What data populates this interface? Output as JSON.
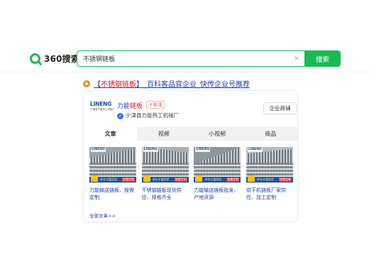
{
  "header": {
    "logo_text": "360搜索",
    "search_value": "不锈钢链板",
    "clear_symbol": "×",
    "search_button": "搜索"
  },
  "result": {
    "title_prefix": "【",
    "title_highlight": "不锈钢链板",
    "title_suffix": "】_百科客品官企业_快传企业号推荐"
  },
  "company": {
    "logo_brand": "LINENG",
    "logo_sub": "宁津县力能热工机械厂",
    "name_prefix": "力能",
    "name_highlight": "链板",
    "follow_label": "+关注",
    "verified_symbol": "✓",
    "subtitle": "宁津县力能热工机械厂",
    "shop_button": "企业商铺"
  },
  "tabs": [
    {
      "label": "文章",
      "active": true
    },
    {
      "label": "视频",
      "active": false
    },
    {
      "label": "小视频",
      "active": false
    },
    {
      "label": "商品",
      "active": false
    }
  ],
  "articles": [
    {
      "title": "力能输送链板、按需定制",
      "thumb_brand": "LINENG",
      "badge_text": "多年丰富经验",
      "tag_text": "按需定制"
    },
    {
      "title": "不锈钢链板现货供应、规格齐全",
      "thumb_brand": "LINENG",
      "badge_text": "多年丰富经验",
      "tag_text": "按需定制"
    },
    {
      "title": "力能输送链板批发、产地货源",
      "thumb_brand": "LINENG",
      "badge_text": "多年丰富经验",
      "tag_text": "按需定制"
    },
    {
      "title": "烘干机链板厂家供应、加工定制",
      "thumb_brand": "LINENG",
      "badge_text": "多年丰富经验",
      "tag_text": "按需定制"
    }
  ],
  "all_articles_link": "全部文章>>",
  "colors": {
    "brand_green": "#19b955",
    "link_blue": "#1a3fb3",
    "highlight_red": "#d21818"
  }
}
